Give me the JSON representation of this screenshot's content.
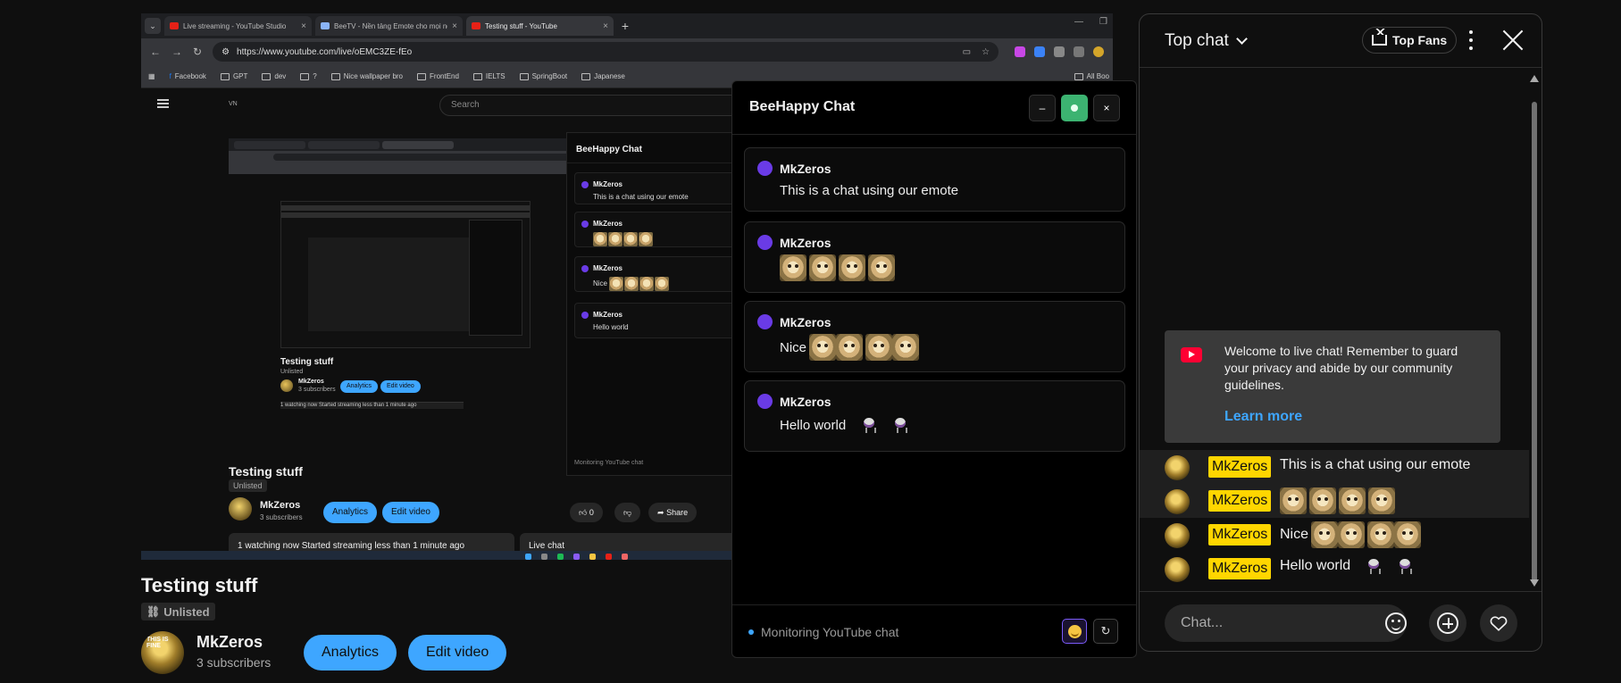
{
  "browser": {
    "tabs": [
      {
        "title": "Live streaming - YouTube Studio"
      },
      {
        "title": "BeeTV - Nền tảng Emote cho mọi ng..."
      },
      {
        "title": "Testing stuff - YouTube"
      }
    ],
    "url": "https://www.youtube.com/live/oEMC3ZE-fEo",
    "bookmarks": [
      "Facebook",
      "GPT",
      "dev",
      "?",
      "Nice wallpaper bro",
      "FrontEnd",
      "IELTS",
      "SpringBoot",
      "Japanese"
    ],
    "all_bookmarks": "All Boo",
    "search_placeholder": "Search",
    "region": "VN"
  },
  "nested": {
    "title": "Testing stuff",
    "unlisted": "Unlisted",
    "channel": "MkZeros",
    "subs": "3 subscribers",
    "analytics": "Analytics",
    "edit": "Edit video",
    "watching": "1 watching now  Started streaming less than 1 minute ago",
    "live_chat": "Live chat",
    "likes": "0",
    "share": "Share",
    "chat_title": "BeeHappy Chat",
    "chat_messages": [
      {
        "name": "MkZeros",
        "text": "This is a chat using our emote"
      },
      {
        "name": "MkZeros",
        "text": ""
      },
      {
        "name": "MkZeros",
        "text": "Nice"
      },
      {
        "name": "MkZeros",
        "text": "Hello world"
      }
    ],
    "monitoring": "Monitoring YouTube chat"
  },
  "page": {
    "title": "Testing stuff",
    "unlisted": "Unlisted",
    "channel": "MkZeros",
    "subscribers": "3 subscribers",
    "analytics_button": "Analytics",
    "edit_button": "Edit video",
    "avatar_text": "THIS IS FINE"
  },
  "bee": {
    "title": "BeeHappy Chat",
    "minimize": "–",
    "close": "×",
    "messages": [
      {
        "name": "MkZeros",
        "text": "This is a chat using our emote",
        "emotes": 0,
        "stickers": 0
      },
      {
        "name": "MkZeros",
        "text": "",
        "emotes": 4,
        "stickers": 0
      },
      {
        "name": "MkZeros",
        "text": "Nice",
        "emotes": 4,
        "stickers": 0
      },
      {
        "name": "MkZeros",
        "text": "Hello world",
        "emotes": 0,
        "stickers": 2
      }
    ],
    "status": "Monitoring YouTube chat",
    "accent": "#6a3be6",
    "status_green": "#3cb371"
  },
  "ytchat": {
    "mode": "Top chat",
    "top_fans": "Top Fans",
    "welcome": "Welcome to live chat! Remember to guard your privacy and abide by our community guidelines.",
    "learn_more": "Learn more",
    "messages": [
      {
        "author": "MkZeros",
        "text": "This is a chat using our emote",
        "emotes": 0,
        "stickers": 0
      },
      {
        "author": "MkZeros",
        "text": "",
        "emotes": 4,
        "stickers": 0
      },
      {
        "author": "MkZeros",
        "text": "Nice",
        "emotes": 4,
        "stickers": 0
      },
      {
        "author": "MkZeros",
        "text": "Hello world",
        "emotes": 0,
        "stickers": 2
      }
    ],
    "input_placeholder": "Chat...",
    "badge_color": "#ffd600",
    "link_color": "#3ea6ff"
  },
  "icons": [
    "menu-icon",
    "youtube-play-icon",
    "crown-icon",
    "more-vert-icon",
    "close-icon",
    "emoji-icon",
    "plus-icon",
    "heart-icon",
    "refresh-icon",
    "link-icon"
  ]
}
